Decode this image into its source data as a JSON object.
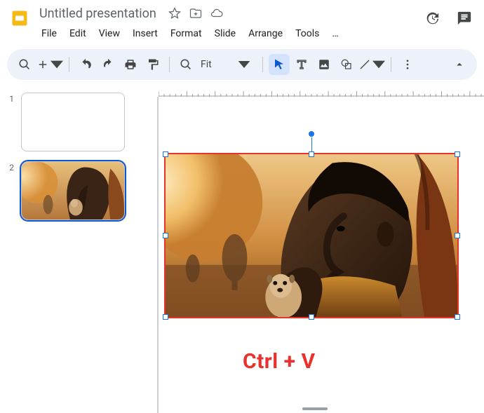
{
  "app": {
    "doc_title": "Untitled presentation"
  },
  "menus": {
    "file": "File",
    "edit": "Edit",
    "view": "View",
    "insert": "Insert",
    "format": "Format",
    "slide": "Slide",
    "arrange": "Arrange",
    "tools": "Tools",
    "more": "…"
  },
  "toolbar": {
    "zoom_label": "Fit"
  },
  "thumbnails": [
    {
      "num": "1",
      "active": false,
      "has_image": false
    },
    {
      "num": "2",
      "active": true,
      "has_image": true
    }
  ],
  "annotation": {
    "shortcut": "Ctrl + V"
  },
  "colors": {
    "accent": "#0b57d0",
    "selection": "#e8322d",
    "logo": "#f5ba15"
  }
}
